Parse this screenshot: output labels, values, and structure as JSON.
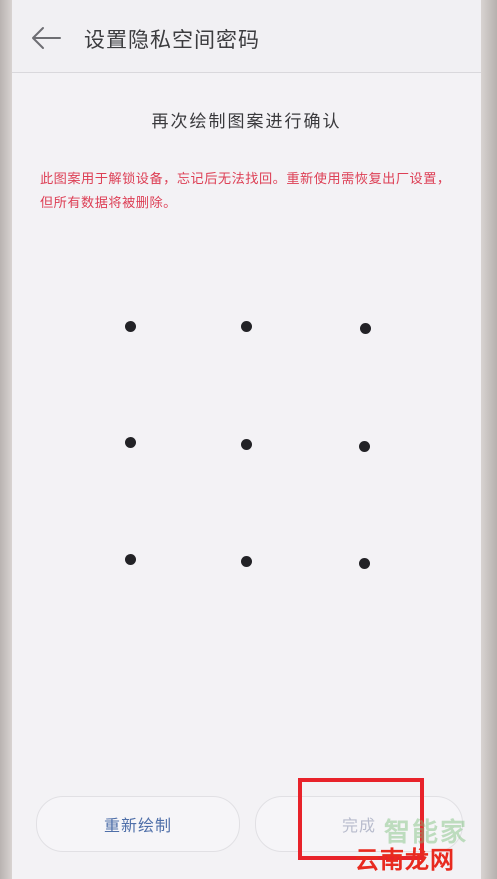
{
  "header": {
    "title": "设置隐私空间密码",
    "back_icon": "arrow-left-icon"
  },
  "pattern": {
    "prompt": "再次绘制图案进行确认",
    "warning": "此图案用于解锁设备，忘记后无法找回。重新使用需恢复出厂设置，但所有数据将被删除。"
  },
  "buttons": {
    "redraw": "重新绘制",
    "done": "完成"
  },
  "watermark": {
    "line1": "智能家",
    "line2": "云南龙网"
  },
  "colors": {
    "warning": "#dd3f55",
    "primary_button_text": "#4f6fa9",
    "disabled_button_text": "#b8bccd",
    "highlight": "#e8222a"
  }
}
